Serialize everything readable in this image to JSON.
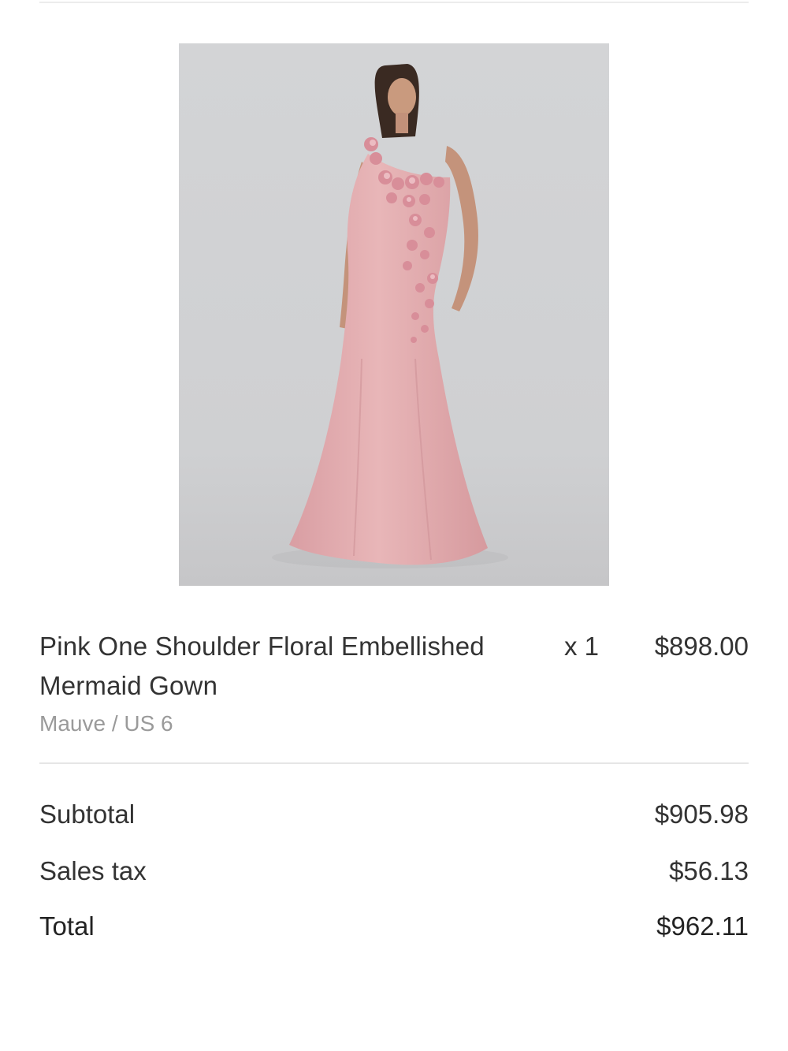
{
  "cart": {
    "item": {
      "image_alt": "Pink One Shoulder Floral Embellished Mermaid Gown",
      "name": "Pink One Shoulder Floral Embellished Mermaid Gown",
      "variant": "Mauve / US 6",
      "quantity": "x 1",
      "price": "$898.00"
    },
    "summary": {
      "subtotal_label": "Subtotal",
      "subtotal_value": "$905.98",
      "tax_label": "Sales tax",
      "tax_value": "$56.13",
      "total_label": "Total",
      "total_value": "$962.11"
    }
  },
  "colors": {
    "background": "#ffffff",
    "text": "#333333",
    "muted_text": "#9a9a9a",
    "divider": "#e6e6e6",
    "dress": "#e3aeb0",
    "photo_backdrop": "#cdcfd1"
  }
}
